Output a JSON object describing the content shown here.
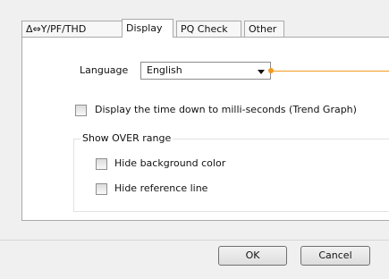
{
  "tabs": [
    {
      "label": "Δ⇔Y/PF/THD"
    },
    {
      "label": "Display"
    },
    {
      "label": "PQ Check"
    },
    {
      "label": "Other"
    }
  ],
  "display": {
    "language_label": "Language",
    "language_value": "English",
    "millis_label": "Display the time down to milli-seconds (Trend Graph)",
    "over_range_title": "Show OVER range",
    "hide_bg_label": "Hide background color",
    "hide_ref_label": "Hide reference line"
  },
  "buttons": {
    "ok": "OK",
    "cancel": "Cancel"
  }
}
